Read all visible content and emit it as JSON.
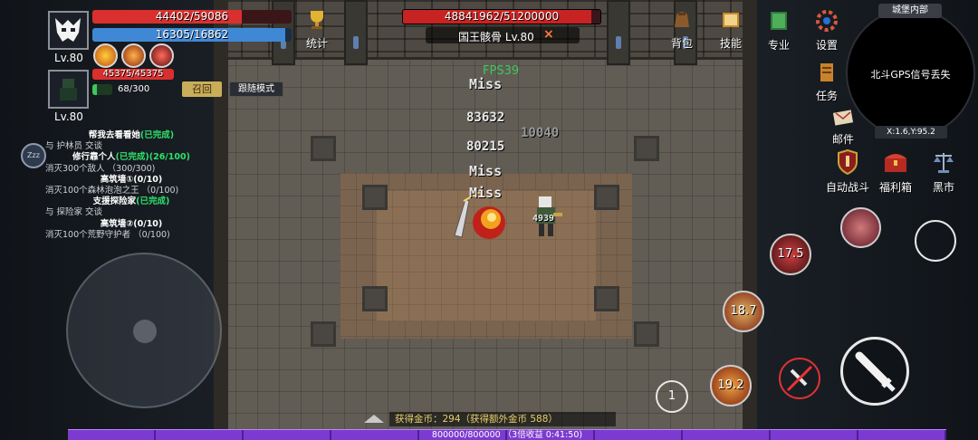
{
  "player": {
    "level": "Lv.80",
    "hp": "44402/59086",
    "hp_ratio": 0.7515,
    "mp": "16305/16862",
    "mp_ratio": 0.967,
    "buff_count": 3
  },
  "pet": {
    "level": "Lv.80",
    "hp": "45375/45375",
    "hp_ratio": 1.0,
    "exp": "68/300",
    "exp_ratio": 0.227,
    "recall_label": "召回",
    "follow_mode_label": "跟随模式"
  },
  "boss": {
    "hp": "48841962/51200000",
    "hp_ratio": 0.954,
    "name": "国王骸骨 Lv.80",
    "close_glyph": "×"
  },
  "top_menu": [
    {
      "label": "统计",
      "icon": "trophy-icon"
    },
    {
      "label": "背包",
      "icon": "bag-icon"
    },
    {
      "label": "技能",
      "icon": "skill-book-icon"
    }
  ],
  "right_menu": {
    "specialty": "专业",
    "settings": "设置",
    "tasks": "任务",
    "mail": "邮件",
    "auto_battle": "自动战斗",
    "welfare": "福利箱",
    "black_market": "黑市"
  },
  "minimap": {
    "title": "城堡内部",
    "message": "北斗GPS信号丢失",
    "coords": "X:1.6,Y:95.2"
  },
  "fps": "FPS39",
  "combat_texts": [
    {
      "text": "Miss",
      "color": "#e8e8e8"
    },
    {
      "text": "83632",
      "color": "#e8e8e8"
    },
    {
      "text": "10040",
      "color": "#9a9a9a"
    },
    {
      "text": "80215",
      "color": "#e8e8e8"
    },
    {
      "text": "Miss",
      "color": "#e8e8e8"
    },
    {
      "text": "Miss",
      "color": "#e8e8e8"
    },
    {
      "text": "4939",
      "color": "#e8e8e8"
    }
  ],
  "quests": [
    {
      "title": "帮我去看看她",
      "status": "(已完成)",
      "detail": "与 护林员 交谈"
    },
    {
      "title": "修行靠个人",
      "status": "(已完成)(26/100)",
      "detail": "消灭300个敌人 （300/300)"
    },
    {
      "title": "高筑墙①(0/10)",
      "status": "",
      "detail": "消灭100个森林泡泡之王 （0/100)"
    },
    {
      "title": "支援探险家",
      "status": "(已完成)",
      "detail": "与 探险家 交谈"
    },
    {
      "title": "高筑墙②(0/10)",
      "status": "",
      "detail": "消灭100个荒野守护者 （0/100)"
    }
  ],
  "sleep_badge": "Zzz",
  "skills": [
    {
      "cooldown": "17.5"
    },
    {
      "cooldown": "18.7"
    },
    {
      "cooldown": "19.2"
    }
  ],
  "skill_page": "1",
  "gold_message": "获得金币：294（获得额外金币 588）",
  "exp_bar": {
    "text": "800000/800000 （3倍收益 0:41:50)",
    "ratio": 1.0
  },
  "colors": {
    "hp": "#d9302f",
    "mp": "#3f88d6",
    "exp": "#7c3ad0",
    "quest_done": "#2ee06b"
  }
}
